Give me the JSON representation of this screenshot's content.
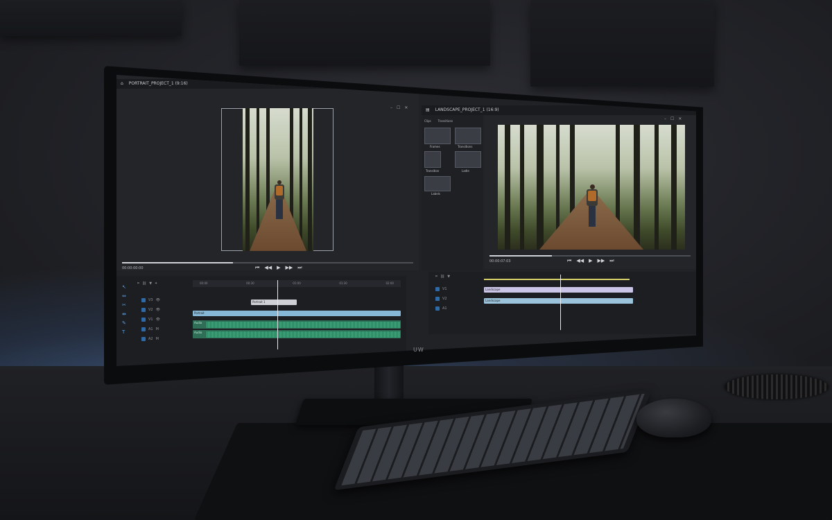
{
  "left_window": {
    "title": "PORTRAIT_PROJECT_1 (9:16)",
    "timecode": "00:00:00:00",
    "window_controls": [
      "–",
      "☐",
      "✕"
    ]
  },
  "right_window": {
    "title": "LANDSCAPE_PROJECT_1 (16:9)",
    "timecode": "00:00:07:03",
    "window_controls": [
      "–",
      "☐",
      "✕"
    ]
  },
  "media_panel": {
    "tabs": [
      "Clips",
      "Transitions"
    ],
    "items": [
      "Frames",
      "Transitions",
      "Transition",
      "Ladle",
      "Labels"
    ]
  },
  "timeline": {
    "ruler_left": [
      "00:00",
      "00:30",
      "01:00",
      "01:30",
      "02:00"
    ],
    "clip_label": "Portrait 1",
    "track_label": "Portrait",
    "audio_labels": [
      "Audio",
      "Audio"
    ],
    "right_clip_label": "Landscape",
    "right_clip2_label": "Landscape"
  },
  "monitor_logo": "UW",
  "transport_glyphs": [
    "⏮",
    "◀◀",
    "▶",
    "▶▶",
    "⏭"
  ]
}
